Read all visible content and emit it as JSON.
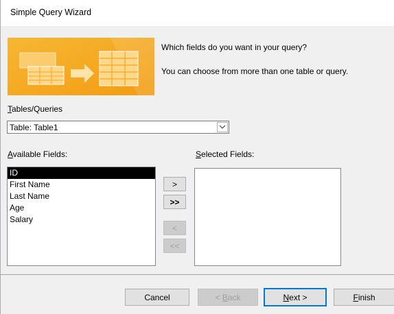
{
  "window": {
    "title": "Simple Query Wizard"
  },
  "prompt": {
    "question": "Which fields do you want in your query?",
    "hint": "You can choose from more than one table or query."
  },
  "tables": {
    "label_u": "T",
    "label_rest": "ables/Queries",
    "selected": "Table: Table1"
  },
  "available": {
    "label_u": "A",
    "label_rest": "vailable Fields:",
    "items": [
      "ID",
      "First Name",
      "Last Name",
      "Age",
      "Salary"
    ],
    "selected_index": 0
  },
  "selected_fields": {
    "label_u": "S",
    "label_rest": "elected Fields:",
    "items": []
  },
  "move_buttons": {
    "add_one": ">",
    "add_all": ">>",
    "remove_one": "<",
    "remove_all": "<<"
  },
  "footer": {
    "cancel": "Cancel",
    "back_pre": "< ",
    "back_u": "B",
    "back_post": "ack",
    "next_u": "N",
    "next_post": "ext >",
    "finish_u": "F",
    "finish_post": "inish"
  },
  "colors": {
    "banner_orange": "#f5a623",
    "selection": "#000000",
    "focus": "#0078d7"
  }
}
